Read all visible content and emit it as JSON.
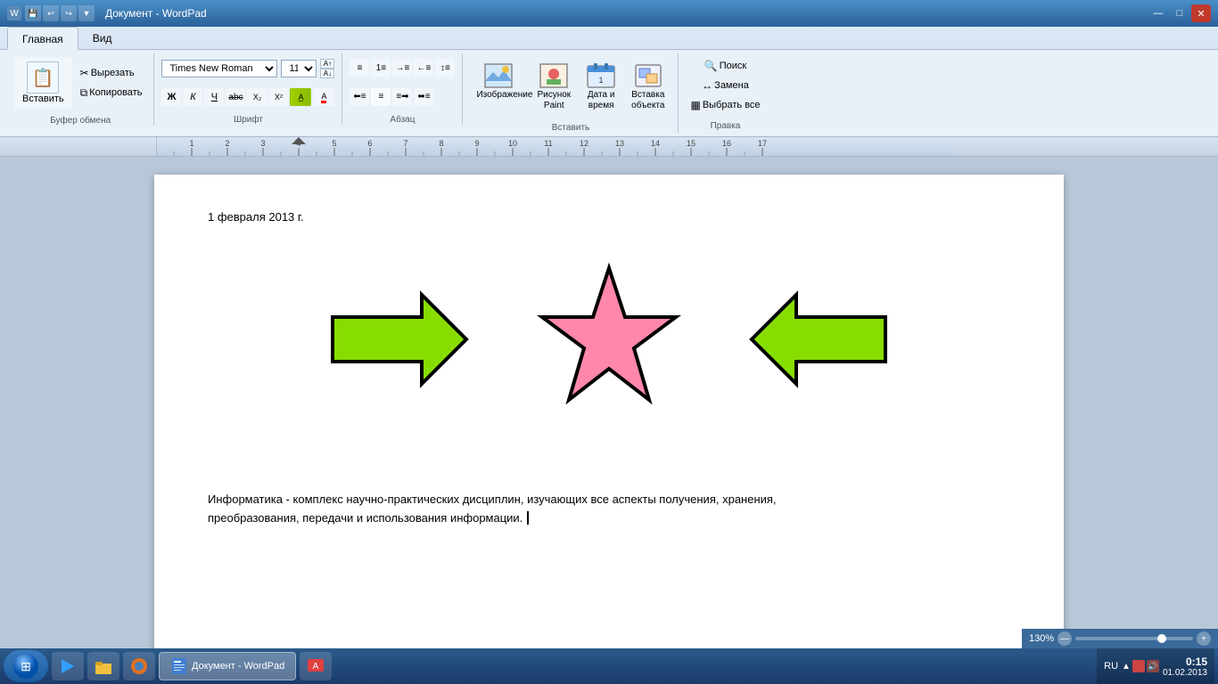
{
  "titlebar": {
    "title": "Документ - WordPad",
    "min_label": "—",
    "max_label": "□",
    "close_label": "✕"
  },
  "tabs": {
    "home": "Главная",
    "view": "Вид"
  },
  "ribbon": {
    "groups": {
      "clipboard": {
        "label": "Буфер обмена",
        "paste": "Вставить",
        "cut": "Вырезать",
        "copy": "Копировать"
      },
      "font": {
        "label": "Шрифт",
        "font_name": "Times New Roman",
        "font_size": "11",
        "bold": "Ж",
        "italic": "К",
        "underline": "Ч",
        "strikethrough": "abc",
        "subscript": "X₂",
        "superscript": "X²"
      },
      "paragraph": {
        "label": "Абзац",
        "align_left": "≡",
        "align_center": "≡",
        "align_right": "≡",
        "align_justify": "≡",
        "line_spacing": "≡"
      },
      "insert": {
        "label": "Вставить",
        "picture": "Изображение",
        "paint": "Рисунок\nPaint",
        "datetime": "Дата и\nвремя",
        "object": "Вставка\nобъекта"
      },
      "editing": {
        "label": "Правка",
        "find": "Поиск",
        "replace": "Замена",
        "select_all": "Выбрать все"
      }
    }
  },
  "document": {
    "date_text": "1 февраля 2013 г.",
    "body_text": "Информатика - комплекс научно-практических дисциплин, изучающих все аспекты получения, хранения, преобразования, передачи и использования информации."
  },
  "statusbar": {
    "zoom_level": "130%"
  },
  "taskbar": {
    "time": "0:15",
    "date": "01.02.2013",
    "language": "RU"
  }
}
